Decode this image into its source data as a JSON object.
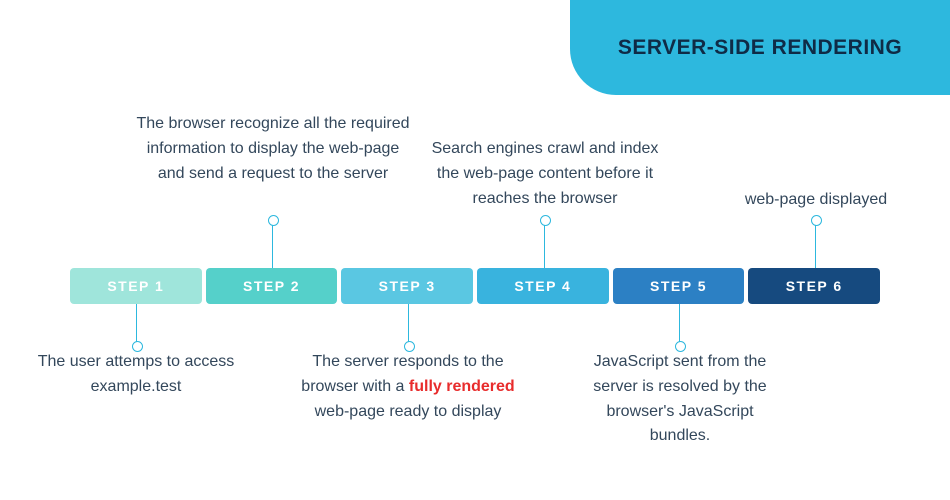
{
  "banner": {
    "title": "SERVER-SIDE RENDERING"
  },
  "steps": [
    {
      "label": "STEP 1",
      "color": "#9FE5DB",
      "desc": "The user attemps to access example.test",
      "position": "below"
    },
    {
      "label": "STEP 2",
      "color": "#55D0CA",
      "desc": "The browser recognize all the required information to display the web-page and send a request to the server",
      "position": "above"
    },
    {
      "label": "STEP 3",
      "color": "#5AC7E2",
      "desc_pre": "The server responds to the browser with a ",
      "desc_highlight": "fully rendered",
      "desc_post": " web-page ready to display",
      "position": "below"
    },
    {
      "label": "STEP 4",
      "color": "#39B3DE",
      "desc": "Search engines crawl and index the web-page content before it reaches the browser",
      "position": "above"
    },
    {
      "label": "STEP 5",
      "color": "#2C80C4",
      "desc": "JavaScript sent from the server is resolved by the browser's JavaScript bundles.",
      "position": "below"
    },
    {
      "label": "STEP 6",
      "color": "#164A7F",
      "desc": "web-page displayed",
      "position": "above"
    }
  ]
}
